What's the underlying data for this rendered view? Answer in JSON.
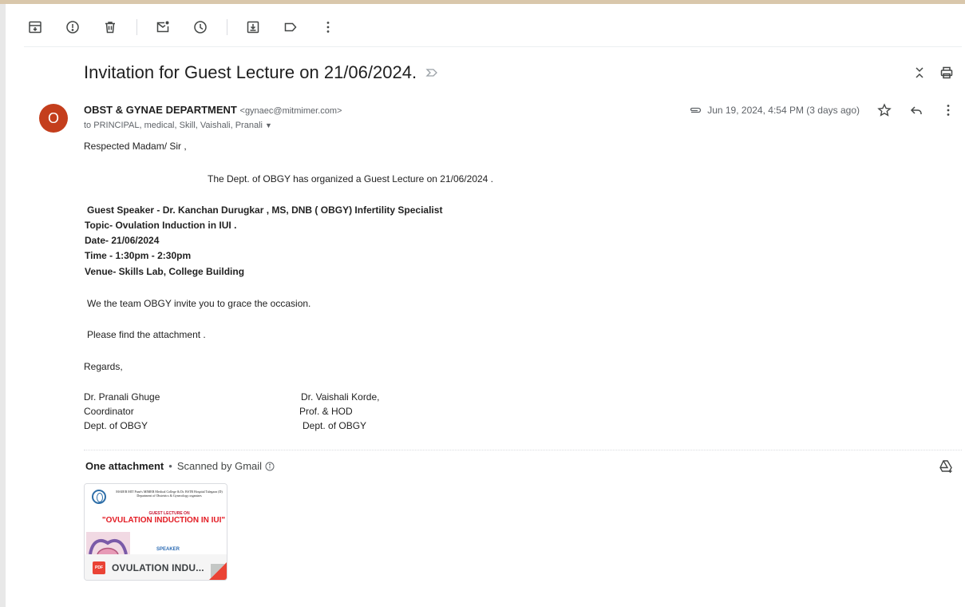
{
  "subject": "Invitation for Guest Lecture on 21/06/2024.",
  "sender": {
    "avatar_letter": "O",
    "name": "OBST & GYNAE DEPARTMENT",
    "email": "<gynaec@mitmimer.com>",
    "recipients": "to PRINCIPAL, medical, Skill, Vaishali, Pranali"
  },
  "meta": {
    "datetime": "Jun 19, 2024, 4:54 PM (3 days ago)"
  },
  "body": {
    "greeting": "Respected Madam/ Sir ,",
    "intro": "The Dept. of OBGY  has organized a Guest Lecture on 21/06/2024 .",
    "speaker": "Guest Speaker - Dr.  Kanchan Durugkar , MS, DNB ( OBGY) Infertility Specialist",
    "topic": "Topic-  Ovulation Induction in IUI .",
    "date": "Date- 21/06/2024",
    "time": "Time -  1:30pm - 2:30pm",
    "venue": "Venue- Skills Lab, College Building",
    "invite": "We the team OBGY invite you to grace the occasion.",
    "attachment_note": "Please find the attachment .",
    "regards": "Regards,",
    "sig_left": [
      "Dr. Pranali Ghuge",
      "Coordinator",
      "Dept. of OBGY"
    ],
    "sig_right": [
      "Dr. Vaishali Korde,",
      "Prof. & HOD",
      "Dept. of OBGY"
    ]
  },
  "attachments": {
    "title": "One attachment",
    "separator": "•",
    "scanned": "Scanned by Gmail",
    "file": {
      "name": "OVULATION INDU...",
      "type_badge": "PDF",
      "thumb_header": "MAEER MIT Pune's MIMER Medical College & Dr. BSTR Hospital Talegaon (D) Department of Obstetrics & Gynecology organizes",
      "thumb_subtitle": "GUEST LECTURE ON",
      "thumb_title": "\"OVULATION INDUCTION IN IUI\"",
      "thumb_speaker": "SPEAKER"
    }
  },
  "colors": {
    "avatar_bg": "#c43e1c",
    "pdf_red": "#ea4335",
    "thumb_title_red": "#e31b23"
  }
}
